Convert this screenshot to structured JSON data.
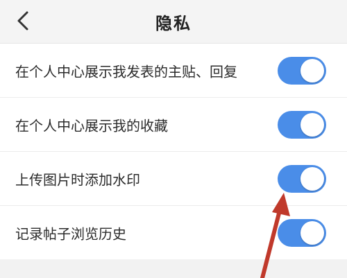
{
  "header": {
    "title": "隐私"
  },
  "settings": [
    {
      "label": "在个人中心展示我发表的主贴、回复",
      "enabled": true
    },
    {
      "label": "在个人中心展示我的收藏",
      "enabled": true
    },
    {
      "label": "上传图片时添加水印",
      "enabled": true
    },
    {
      "label": "记录帖子浏览历史",
      "enabled": true
    }
  ],
  "colors": {
    "toggle_on": "#4a8de8",
    "annotation_arrow": "#c0392b"
  },
  "icons": {
    "back": "chevron-left-icon"
  }
}
